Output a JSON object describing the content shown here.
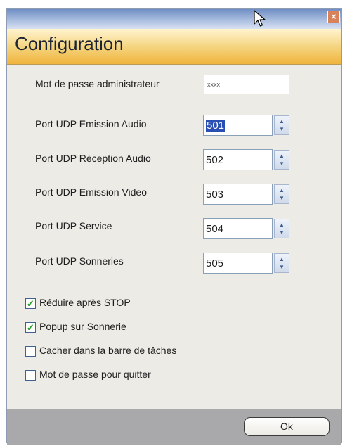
{
  "window": {
    "close_glyph": "×"
  },
  "header": {
    "title": "Configuration"
  },
  "form": {
    "admin_password_label": "Mot de passe administrateur",
    "admin_password_value": "xxxx",
    "ports": [
      {
        "label": "Port UDP Emission Audio",
        "value": "501"
      },
      {
        "label": "Port UDP Réception Audio",
        "value": "502"
      },
      {
        "label": "Port UDP Emission Video",
        "value": "503"
      },
      {
        "label": "Port UDP Service",
        "value": "504"
      },
      {
        "label": "Port UDP Sonneries",
        "value": "505"
      }
    ]
  },
  "options": [
    {
      "label": "Réduire après STOP",
      "checked": true
    },
    {
      "label": "Popup sur Sonnerie",
      "checked": true
    },
    {
      "label": "Cacher dans la barre de tâches",
      "checked": false
    },
    {
      "label": "Mot de passe pour quitter",
      "checked": false
    }
  ],
  "footer": {
    "ok_label": "Ok"
  },
  "icons": {
    "close": "close-icon",
    "spinner": "spinner-arrows-icon",
    "check": "checkmark-icon",
    "cursor": "mouse-pointer-icon"
  }
}
